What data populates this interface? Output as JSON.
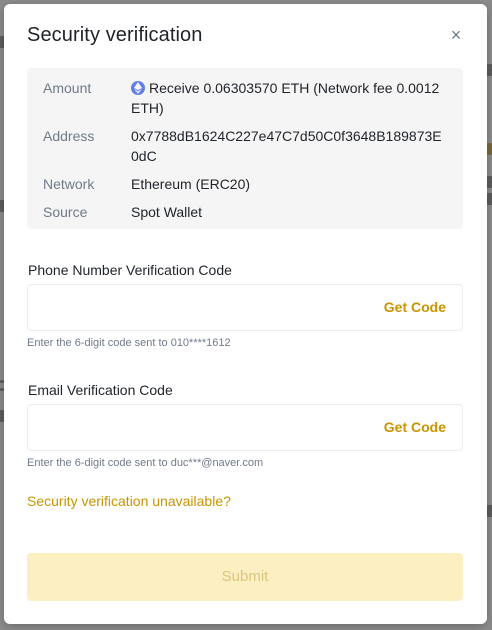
{
  "modal": {
    "title": "Security verification",
    "close_glyph": "×"
  },
  "details": {
    "amount_label": "Amount",
    "amount_value": "Receive 0.06303570 ETH (Network fee 0.0012 ETH)",
    "amount_icon": "ethereum-icon",
    "address_label": "Address",
    "address_value": "0x7788dB1624C227e47C7d50C0f3648B189873E0dC",
    "network_label": "Network",
    "network_value": "Ethereum (ERC20)",
    "source_label": "Source",
    "source_value": "Spot Wallet"
  },
  "phone": {
    "label": "Phone Number Verification Code",
    "value": "",
    "get_code": "Get Code",
    "hint": "Enter the 6-digit code sent to 010****1612"
  },
  "email": {
    "label": "Email Verification Code",
    "value": "",
    "get_code": "Get Code",
    "hint": "Enter the 6-digit code sent to duc***@naver.com"
  },
  "unavailable_link": "Security verification unavailable?",
  "submit_label": "Submit",
  "colors": {
    "accent": "#c99400",
    "submit_bg": "#fcf0c2",
    "submit_text": "#dcc57e",
    "info_bg": "#f5f5f5",
    "eth": "#627eea"
  }
}
